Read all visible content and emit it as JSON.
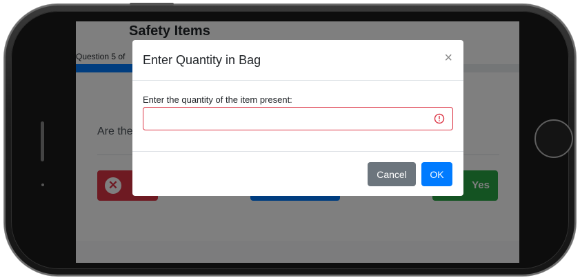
{
  "app": {
    "title": "Safety Items",
    "question_label": "Question 5 of",
    "question_text": "Are there",
    "progress": 0.13,
    "yes_label": "Yes"
  },
  "modal": {
    "title": "Enter Quantity in Bag",
    "close_glyph": "×",
    "field_label": "Enter the quantity of the item present:",
    "field_value": "",
    "cancel_label": "Cancel",
    "ok_label": "OK"
  },
  "colors": {
    "primary": "#007bff",
    "danger": "#dc3545",
    "success": "#28a745",
    "secondary": "#6c757d"
  },
  "icons": {
    "close": "close-icon",
    "no_button": "x-circle-icon",
    "input_warning": "exclamation-circle-icon"
  }
}
